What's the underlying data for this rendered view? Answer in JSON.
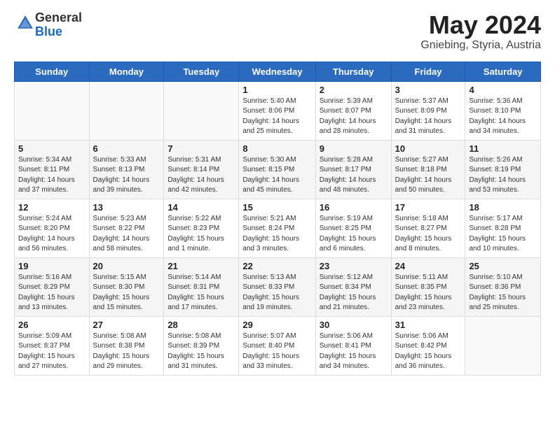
{
  "header": {
    "logo_general": "General",
    "logo_blue": "Blue",
    "main_title": "May 2024",
    "subtitle": "Gniebing, Styria, Austria"
  },
  "calendar": {
    "days_of_week": [
      "Sunday",
      "Monday",
      "Tuesday",
      "Wednesday",
      "Thursday",
      "Friday",
      "Saturday"
    ],
    "weeks": [
      [
        {
          "day": "",
          "info": ""
        },
        {
          "day": "",
          "info": ""
        },
        {
          "day": "",
          "info": ""
        },
        {
          "day": "1",
          "info": "Sunrise: 5:40 AM\nSunset: 8:06 PM\nDaylight: 14 hours\nand 25 minutes."
        },
        {
          "day": "2",
          "info": "Sunrise: 5:39 AM\nSunset: 8:07 PM\nDaylight: 14 hours\nand 28 minutes."
        },
        {
          "day": "3",
          "info": "Sunrise: 5:37 AM\nSunset: 8:09 PM\nDaylight: 14 hours\nand 31 minutes."
        },
        {
          "day": "4",
          "info": "Sunrise: 5:36 AM\nSunset: 8:10 PM\nDaylight: 14 hours\nand 34 minutes."
        }
      ],
      [
        {
          "day": "5",
          "info": "Sunrise: 5:34 AM\nSunset: 8:11 PM\nDaylight: 14 hours\nand 37 minutes."
        },
        {
          "day": "6",
          "info": "Sunrise: 5:33 AM\nSunset: 8:13 PM\nDaylight: 14 hours\nand 39 minutes."
        },
        {
          "day": "7",
          "info": "Sunrise: 5:31 AM\nSunset: 8:14 PM\nDaylight: 14 hours\nand 42 minutes."
        },
        {
          "day": "8",
          "info": "Sunrise: 5:30 AM\nSunset: 8:15 PM\nDaylight: 14 hours\nand 45 minutes."
        },
        {
          "day": "9",
          "info": "Sunrise: 5:28 AM\nSunset: 8:17 PM\nDaylight: 14 hours\nand 48 minutes."
        },
        {
          "day": "10",
          "info": "Sunrise: 5:27 AM\nSunset: 8:18 PM\nDaylight: 14 hours\nand 50 minutes."
        },
        {
          "day": "11",
          "info": "Sunrise: 5:26 AM\nSunset: 8:19 PM\nDaylight: 14 hours\nand 53 minutes."
        }
      ],
      [
        {
          "day": "12",
          "info": "Sunrise: 5:24 AM\nSunset: 8:20 PM\nDaylight: 14 hours\nand 56 minutes."
        },
        {
          "day": "13",
          "info": "Sunrise: 5:23 AM\nSunset: 8:22 PM\nDaylight: 14 hours\nand 58 minutes."
        },
        {
          "day": "14",
          "info": "Sunrise: 5:22 AM\nSunset: 8:23 PM\nDaylight: 15 hours\nand 1 minute."
        },
        {
          "day": "15",
          "info": "Sunrise: 5:21 AM\nSunset: 8:24 PM\nDaylight: 15 hours\nand 3 minutes."
        },
        {
          "day": "16",
          "info": "Sunrise: 5:19 AM\nSunset: 8:25 PM\nDaylight: 15 hours\nand 6 minutes."
        },
        {
          "day": "17",
          "info": "Sunrise: 5:18 AM\nSunset: 8:27 PM\nDaylight: 15 hours\nand 8 minutes."
        },
        {
          "day": "18",
          "info": "Sunrise: 5:17 AM\nSunset: 8:28 PM\nDaylight: 15 hours\nand 10 minutes."
        }
      ],
      [
        {
          "day": "19",
          "info": "Sunrise: 5:16 AM\nSunset: 8:29 PM\nDaylight: 15 hours\nand 13 minutes."
        },
        {
          "day": "20",
          "info": "Sunrise: 5:15 AM\nSunset: 8:30 PM\nDaylight: 15 hours\nand 15 minutes."
        },
        {
          "day": "21",
          "info": "Sunrise: 5:14 AM\nSunset: 8:31 PM\nDaylight: 15 hours\nand 17 minutes."
        },
        {
          "day": "22",
          "info": "Sunrise: 5:13 AM\nSunset: 8:33 PM\nDaylight: 15 hours\nand 19 minutes."
        },
        {
          "day": "23",
          "info": "Sunrise: 5:12 AM\nSunset: 8:34 PM\nDaylight: 15 hours\nand 21 minutes."
        },
        {
          "day": "24",
          "info": "Sunrise: 5:11 AM\nSunset: 8:35 PM\nDaylight: 15 hours\nand 23 minutes."
        },
        {
          "day": "25",
          "info": "Sunrise: 5:10 AM\nSunset: 8:36 PM\nDaylight: 15 hours\nand 25 minutes."
        }
      ],
      [
        {
          "day": "26",
          "info": "Sunrise: 5:09 AM\nSunset: 8:37 PM\nDaylight: 15 hours\nand 27 minutes."
        },
        {
          "day": "27",
          "info": "Sunrise: 5:08 AM\nSunset: 8:38 PM\nDaylight: 15 hours\nand 29 minutes."
        },
        {
          "day": "28",
          "info": "Sunrise: 5:08 AM\nSunset: 8:39 PM\nDaylight: 15 hours\nand 31 minutes."
        },
        {
          "day": "29",
          "info": "Sunrise: 5:07 AM\nSunset: 8:40 PM\nDaylight: 15 hours\nand 33 minutes."
        },
        {
          "day": "30",
          "info": "Sunrise: 5:06 AM\nSunset: 8:41 PM\nDaylight: 15 hours\nand 34 minutes."
        },
        {
          "day": "31",
          "info": "Sunrise: 5:06 AM\nSunset: 8:42 PM\nDaylight: 15 hours\nand 36 minutes."
        },
        {
          "day": "",
          "info": ""
        }
      ]
    ]
  }
}
